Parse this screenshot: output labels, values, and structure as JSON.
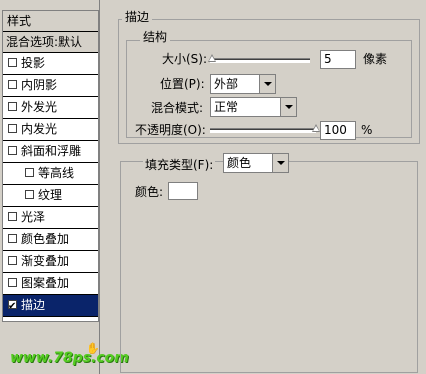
{
  "styles_panel": {
    "header": "样式",
    "blending_options": "混合选项:默认",
    "items": [
      {
        "label": "投影",
        "checked": false,
        "indent": false,
        "selected": false
      },
      {
        "label": "内阴影",
        "checked": false,
        "indent": false,
        "selected": false
      },
      {
        "label": "外发光",
        "checked": false,
        "indent": false,
        "selected": false
      },
      {
        "label": "内发光",
        "checked": false,
        "indent": false,
        "selected": false
      },
      {
        "label": "斜面和浮雕",
        "checked": false,
        "indent": false,
        "selected": false
      },
      {
        "label": "等高线",
        "checked": false,
        "indent": true,
        "selected": false
      },
      {
        "label": "纹理",
        "checked": false,
        "indent": true,
        "selected": false
      },
      {
        "label": "光泽",
        "checked": false,
        "indent": false,
        "selected": false
      },
      {
        "label": "颜色叠加",
        "checked": false,
        "indent": false,
        "selected": false
      },
      {
        "label": "渐变叠加",
        "checked": false,
        "indent": false,
        "selected": false
      },
      {
        "label": "图案叠加",
        "checked": false,
        "indent": false,
        "selected": false
      },
      {
        "label": "描边",
        "checked": true,
        "indent": false,
        "selected": true
      }
    ],
    "watermark": "www.78ps.com"
  },
  "stroke": {
    "title": "描边",
    "structure": {
      "title": "结构",
      "size_label": "大小(S):",
      "size_value": "5",
      "size_unit": "像素",
      "size_slider_fraction": 0.02,
      "position_label": "位置(P):",
      "position_value": "外部",
      "blend_mode_label": "混合模式:",
      "blend_mode_value": "正常",
      "opacity_label": "不透明度(O):",
      "opacity_value": "100",
      "opacity_unit": "%",
      "opacity_slider_fraction": 1.0
    },
    "fill": {
      "fill_type_label": "填充类型(F):",
      "fill_type_value": "颜色",
      "color_label": "颜色:",
      "color_value": "#ffffff"
    }
  }
}
